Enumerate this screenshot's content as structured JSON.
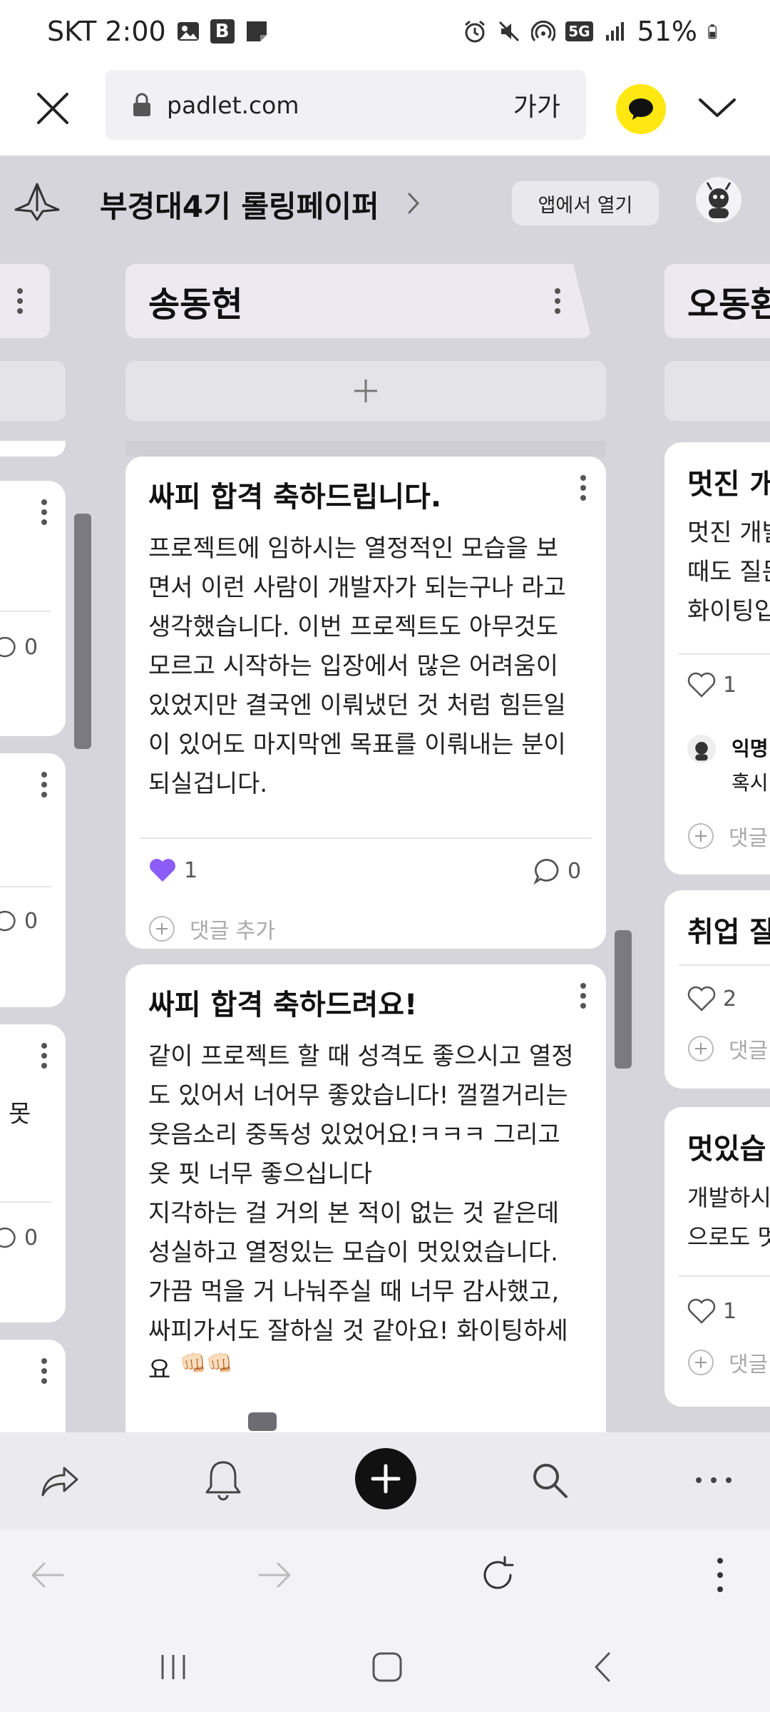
{
  "status_bar": {
    "carrier_time": "SKT 2:00",
    "notif_b": "B",
    "network": "5G",
    "battery": "51%"
  },
  "browser": {
    "url": "padlet.com",
    "text_size_label": "가가"
  },
  "board": {
    "title": "부경대4기 롤링페이퍼",
    "open_in_app": "앱에서 열기"
  },
  "columns": {
    "center": {
      "name": "송동현",
      "posts": [
        {
          "title": "싸피 합격 축하드립니다.",
          "body": "프로젝트에 임하시는 열정적인 모습을 보\n면서 이런 사람이 개발자가 되는구나 라고\n생각했습니다. 이번 프로젝트도 아무것도\n모르고 시작하는 입장에서 많은 어려움이\n있었지만 결국엔 이뤄냈던 것 처럼 힘든일\n이 있어도 마지막엔 목표를 이뤄내는 분이\n되실겁니다.",
          "likes": "1",
          "comments": "0",
          "add_comment": "댓글 추가"
        },
        {
          "title": "싸피 합격 축하드려요!",
          "body": "같이 프로젝트 할 때 성격도 좋으시고 열정\n도 있어서 너어무 좋았습니다! 껄껄거리는\n웃음소리 중독성 있었어요!ㅋㅋㅋ 그리고\n옷 핏 너무 좋으십니다\n지각하는 걸 거의 본 적이 없는 것 같은데\n성실하고 열정있는 모습이 멋있었습니다.\n가끔 먹을 거 나눠주실 때 너무 감사했고,\n싸피가서도 잘하실 것 같아요! 화이팅하세\n요",
          "emoji": "👊🏻👊🏻"
        }
      ]
    },
    "left": {
      "comment_counts": [
        "0",
        "0",
        "0"
      ],
      "partial_text": "못"
    },
    "right": {
      "name": "오동환",
      "posts": [
        {
          "title": "멋진 개",
          "body": "멋진 개발\n때도 질문\n화이팅입",
          "likes": "1",
          "commenter": "익명",
          "comment_text": "혹시",
          "add_comment": "댓글"
        },
        {
          "title": "취업 잘",
          "likes": "2",
          "add_comment": "댓글"
        },
        {
          "title": "멋있습",
          "body": "개발하시\n으로도 멋",
          "likes": "1",
          "add_comment": "댓글"
        }
      ]
    }
  },
  "colors": {
    "board_bg": "#d6d5db",
    "heart_active": "#8b5cf6",
    "kakao": "#ffe812"
  },
  "icons": [
    "close-icon",
    "lock-icon",
    "kakao-icon",
    "chevron-down-icon",
    "board-logo-icon",
    "share-icon",
    "bell-icon",
    "plus-icon",
    "search-icon",
    "more-icon",
    "back-icon",
    "forward-icon",
    "refresh-icon",
    "kebab-icon",
    "heart-icon",
    "comment-icon"
  ]
}
